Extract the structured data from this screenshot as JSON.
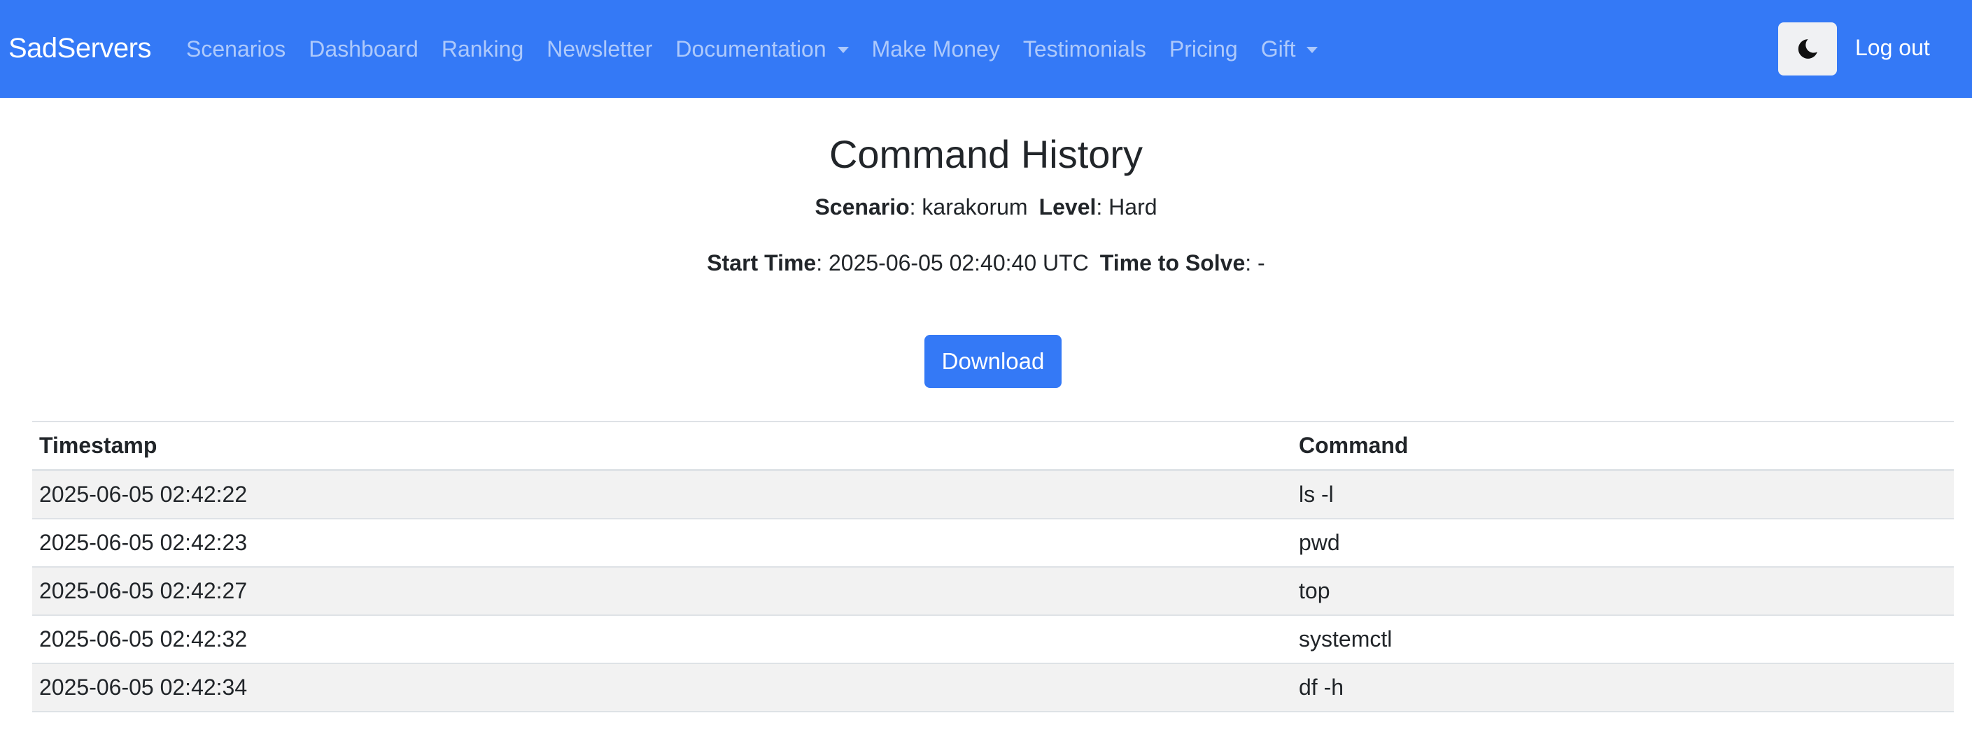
{
  "navbar": {
    "brand": "SadServers",
    "links": [
      {
        "label": "Scenarios",
        "dropdown": false
      },
      {
        "label": "Dashboard",
        "dropdown": false
      },
      {
        "label": "Ranking",
        "dropdown": false
      },
      {
        "label": "Newsletter",
        "dropdown": false
      },
      {
        "label": "Documentation",
        "dropdown": true
      },
      {
        "label": "Make Money",
        "dropdown": false
      },
      {
        "label": "Testimonials",
        "dropdown": false
      },
      {
        "label": "Pricing",
        "dropdown": false
      },
      {
        "label": "Gift",
        "dropdown": true
      }
    ],
    "theme_toggle_icon": "moon-icon",
    "logout_label": "Log out",
    "color": "#3479f6"
  },
  "page": {
    "title": "Command History",
    "scenario_label": "Scenario",
    "scenario_value": "karakorum",
    "level_label": "Level",
    "level_value": "Hard",
    "start_time_label": "Start Time",
    "start_time_value": "2025-06-05 02:40:40 UTC",
    "time_to_solve_label": "Time to Solve",
    "time_to_solve_value": "-",
    "download_label": "Download"
  },
  "table": {
    "headers": {
      "timestamp": "Timestamp",
      "command": "Command"
    },
    "rows": [
      {
        "timestamp": "2025-06-05 02:42:22",
        "command": "ls -l"
      },
      {
        "timestamp": "2025-06-05 02:42:23",
        "command": "pwd"
      },
      {
        "timestamp": "2025-06-05 02:42:27",
        "command": "top"
      },
      {
        "timestamp": "2025-06-05 02:42:32",
        "command": "systemctl"
      },
      {
        "timestamp": "2025-06-05 02:42:34",
        "command": "df -h"
      }
    ]
  }
}
